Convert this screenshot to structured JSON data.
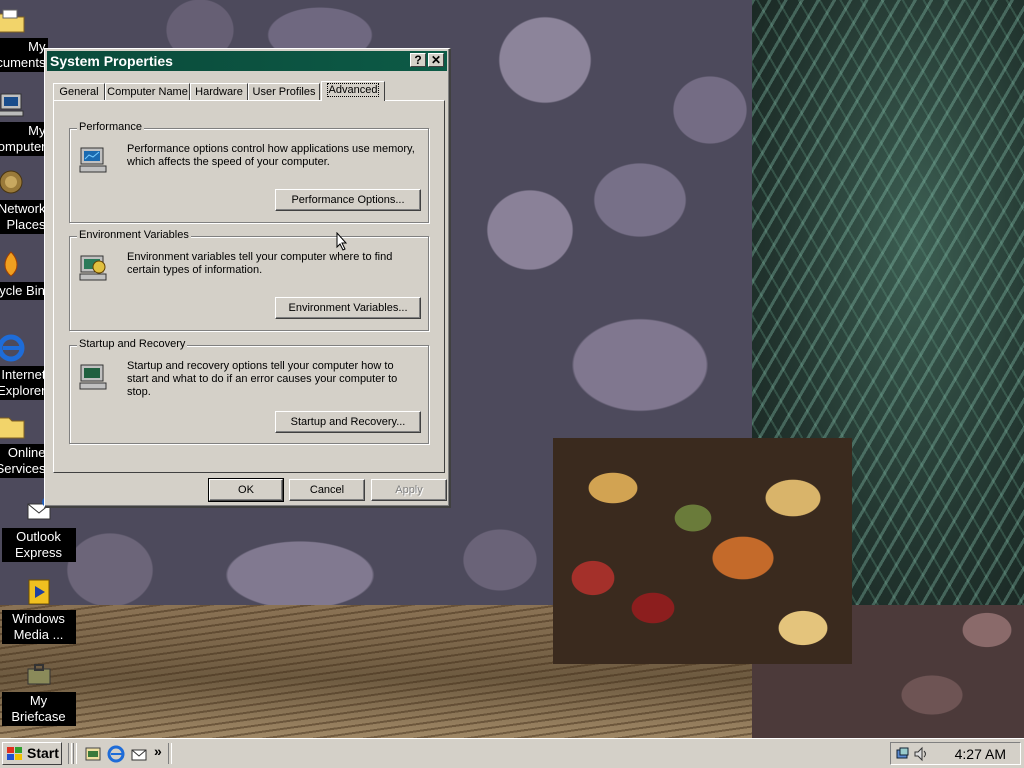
{
  "desktop": {
    "icons": [
      {
        "name": "my-documents",
        "label": "My Documents"
      },
      {
        "name": "my-computer",
        "label": "My Computer"
      },
      {
        "name": "my-network-places",
        "label": "My Network Places"
      },
      {
        "name": "recycle-bin",
        "label": "Recycle Bin"
      },
      {
        "name": "internet-explorer",
        "label": "Internet Explorer"
      },
      {
        "name": "online-services",
        "label": "Online Services"
      },
      {
        "name": "outlook-express",
        "label": "Outlook Express"
      },
      {
        "name": "windows-media",
        "label": "Windows Media ..."
      },
      {
        "name": "my-briefcase",
        "label": "My Briefcase"
      }
    ]
  },
  "dialog": {
    "title": "System Properties",
    "help_glyph": "?",
    "close_glyph": "✕",
    "tabs": [
      "General",
      "Computer Name",
      "Hardware",
      "User Profiles",
      "Advanced"
    ],
    "active_tab": "Advanced",
    "groups": {
      "performance": {
        "legend": "Performance",
        "description": "Performance options control how applications use memory, which affects the speed of your computer.",
        "button": "Performance Options..."
      },
      "environment": {
        "legend": "Environment Variables",
        "description": "Environment variables tell your computer where to find certain types of information.",
        "button": "Environment Variables..."
      },
      "startup": {
        "legend": "Startup and Recovery",
        "description": "Startup and recovery options tell your computer how to start and what to do if an error causes your computer to stop.",
        "button": "Startup and Recovery..."
      }
    },
    "buttons": {
      "ok": "OK",
      "cancel": "Cancel",
      "apply": "Apply"
    }
  },
  "taskbar": {
    "start_label": "Start",
    "quick_launch_more": "»",
    "clock": "4:27 AM"
  },
  "colors": {
    "title_bar": "#0d5a46",
    "face": "#d4d0c8"
  }
}
